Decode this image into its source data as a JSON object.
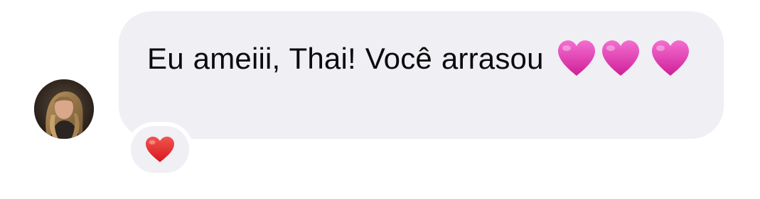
{
  "message": {
    "text": "Eu ameiii, Thai! Você arrasou",
    "emoji_icons": [
      "pink-heart-icon",
      "pink-heart-icon",
      "pink-heart-icon"
    ]
  },
  "reaction": {
    "emoji": "❤️",
    "icon": "red-heart-icon"
  },
  "colors": {
    "bubble_background": "#efeff4",
    "text": "#0b0b0b",
    "pink_heart": "#e83fb3",
    "red_heart": "#e8232f"
  }
}
